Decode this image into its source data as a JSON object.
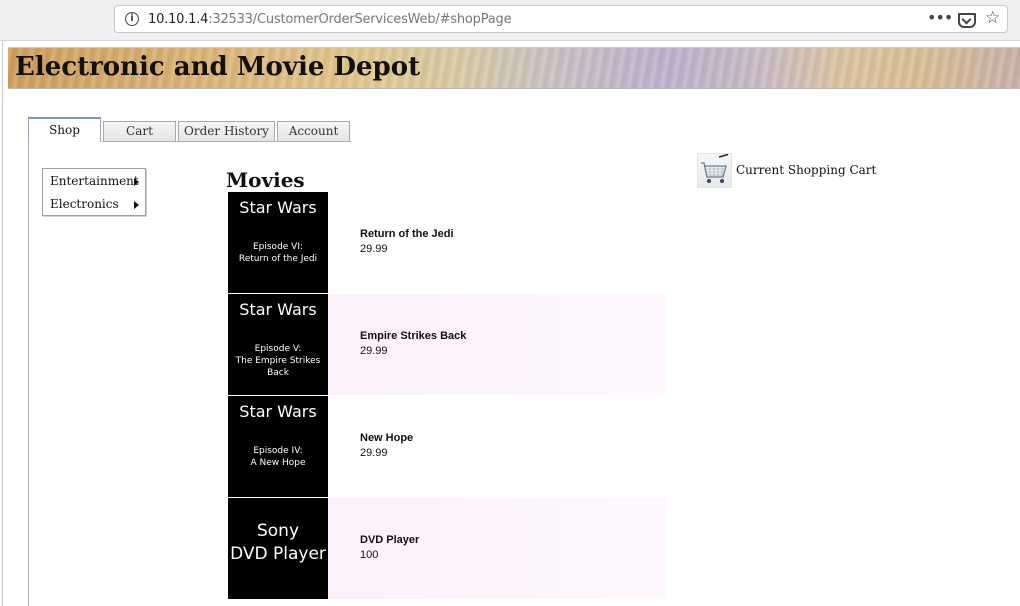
{
  "browser": {
    "url_host": "10.10.1.4",
    "url_rest": ":32533/CustomerOrderServicesWeb/#shopPage",
    "icons": [
      "info-icon",
      "more-icon",
      "pocket-icon",
      "bookmark-star-icon"
    ]
  },
  "header": {
    "title": "Electronic and Movie Depot"
  },
  "tabs": [
    {
      "label": "Shop",
      "active": true
    },
    {
      "label": "Cart",
      "active": false
    },
    {
      "label": "Order History",
      "active": false
    },
    {
      "label": "Account",
      "active": false
    }
  ],
  "categories": [
    {
      "label": "Entertainment"
    },
    {
      "label": "Electronics"
    }
  ],
  "section_title": "Movies",
  "cart_link": {
    "label": "Current Shopping Cart",
    "icon": "shopping-cart-icon"
  },
  "products": [
    {
      "thumb_title": "Star Wars",
      "thumb_sub1": "Episode VI:",
      "thumb_sub2": "Return of the Jedi",
      "name": "Return of the Jedi",
      "price": "29.99"
    },
    {
      "thumb_title": "Star Wars",
      "thumb_sub1": "Episode V:",
      "thumb_sub2": "The Empire Strikes Back",
      "name": "Empire Strikes Back",
      "price": "29.99"
    },
    {
      "thumb_title": "Star Wars",
      "thumb_sub1": "Episode IV:",
      "thumb_sub2": "A New Hope",
      "name": "New Hope",
      "price": "29.99"
    },
    {
      "thumb_line1": "Sony",
      "thumb_line2": "DVD Player",
      "name": "DVD Player",
      "price": "100"
    }
  ],
  "colors": {
    "alt_row": "#fbeefa",
    "thumb_bg": "#000000",
    "active_tab_border": "#8090b0"
  }
}
